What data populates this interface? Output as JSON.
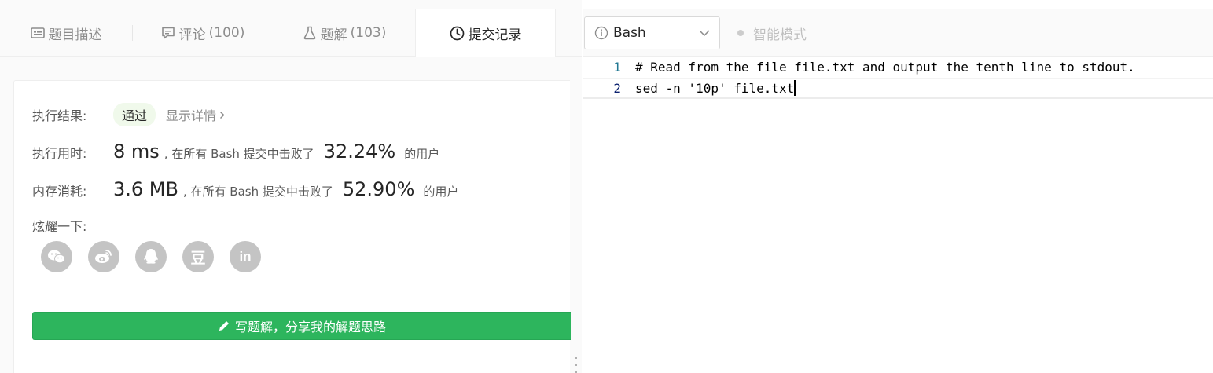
{
  "tabs": [
    {
      "label": "题目描述",
      "count": "",
      "icon": "description-icon"
    },
    {
      "label": "评论",
      "count": "(100)",
      "icon": "comment-icon"
    },
    {
      "label": "题解",
      "count": "(103)",
      "icon": "flask-icon"
    },
    {
      "label": "提交记录",
      "count": "",
      "icon": "clock-icon"
    }
  ],
  "result": {
    "status_label": "执行结果:",
    "status_value": "通过",
    "detail_link": "显示详情",
    "runtime_label": "执行用时:",
    "runtime_value": "8 ms",
    "runtime_text": ", 在所有 Bash 提交中击败了",
    "runtime_pct": "32.24%",
    "runtime_users": "的用户",
    "memory_label": "内存消耗:",
    "memory_value": "3.6 MB",
    "memory_text": ", 在所有 Bash 提交中击败了",
    "memory_pct": "52.90%",
    "memory_users": "的用户",
    "share_label": "炫耀一下:",
    "share_icons": [
      "wechat-icon",
      "weibo-icon",
      "qq-icon",
      "douban-icon",
      "linkedin-icon"
    ],
    "linkedin_text": "in",
    "douban_text": "豆",
    "write_button": "写题解，分享我的解题思路"
  },
  "editor": {
    "language": "Bash",
    "smart_mode": "智能模式",
    "lines": [
      {
        "num": "1",
        "text": "# Read from the file file.txt and output the tenth line to stdout."
      },
      {
        "num": "2",
        "text": "sed -n '10p' file.txt"
      }
    ]
  },
  "colors": {
    "accent_green": "#2db55d",
    "badge_bg": "#f0f9eb",
    "line_number": "#237893"
  }
}
